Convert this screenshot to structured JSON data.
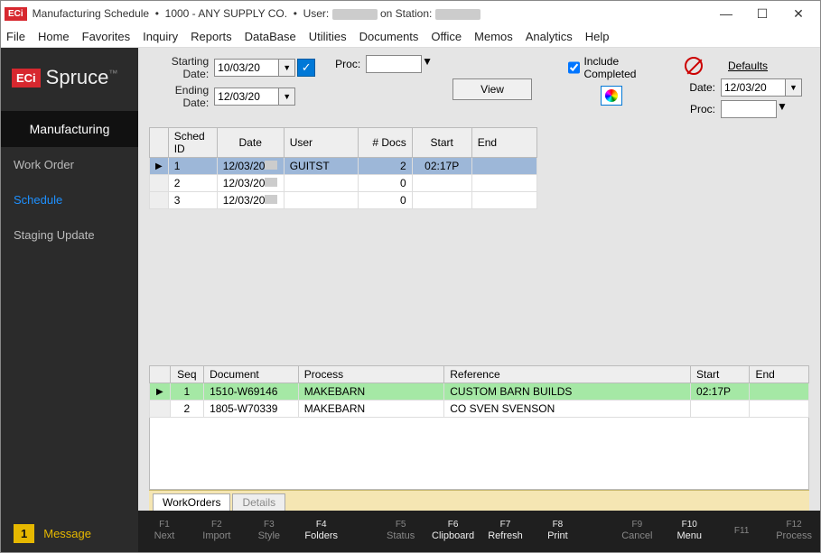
{
  "window": {
    "title_prefix": "Manufacturing Schedule",
    "company": "1000 - ANY SUPPLY CO.",
    "user_label": "User:",
    "station_label": "on Station:"
  },
  "menu": [
    "File",
    "Home",
    "Favorites",
    "Inquiry",
    "Reports",
    "DataBase",
    "Utilities",
    "Documents",
    "Office",
    "Memos",
    "Analytics",
    "Help"
  ],
  "sidebar": {
    "brand_eci": "ECi",
    "brand_name": "Spruce",
    "brand_tm": "™",
    "header": "Manufacturing",
    "items": [
      {
        "label": "Work Order",
        "active": false
      },
      {
        "label": "Schedule",
        "active": true
      },
      {
        "label": "Staging Update",
        "active": false
      }
    ],
    "msg_count": "1",
    "msg_label": "Message"
  },
  "filters": {
    "starting_label": "Starting Date:",
    "starting_value": "10/03/20",
    "ending_label": "Ending Date:",
    "ending_value": "12/03/20",
    "proc_label": "Proc:",
    "view_label": "View",
    "include_label": "Include Completed",
    "include_checked": true
  },
  "defaults": {
    "header": "Defaults",
    "date_label": "Date:",
    "date_value": "12/03/20",
    "proc_label": "Proc:"
  },
  "grid1": {
    "headers": [
      "Sched ID",
      "Date",
      "User",
      "# Docs",
      "Start",
      "End"
    ],
    "rows": [
      {
        "sel": true,
        "id": "1",
        "date": "12/03/20",
        "user": "GUITST",
        "docs": "2",
        "start": "02:17P",
        "end": ""
      },
      {
        "sel": false,
        "id": "2",
        "date": "12/03/20",
        "user": "",
        "docs": "0",
        "start": "",
        "end": ""
      },
      {
        "sel": false,
        "id": "3",
        "date": "12/03/20",
        "user": "",
        "docs": "0",
        "start": "",
        "end": ""
      }
    ]
  },
  "grid2": {
    "headers": [
      "Seq",
      "Document",
      "Process",
      "Reference",
      "Start",
      "End"
    ],
    "rows": [
      {
        "green": true,
        "seq": "1",
        "doc": "1510-W69146",
        "proc": "MAKEBARN",
        "ref": "CUSTOM BARN BUILDS",
        "start": "02:17P",
        "end": ""
      },
      {
        "green": false,
        "seq": "2",
        "doc": "1805-W70339",
        "proc": "MAKEBARN",
        "ref": "CO SVEN SVENSON",
        "start": "",
        "end": ""
      }
    ]
  },
  "tabs": [
    {
      "label": "WorkOrders",
      "active": true
    },
    {
      "label": "Details",
      "active": false
    }
  ],
  "fkeys": [
    {
      "k": "F1",
      "l": "Next",
      "on": false
    },
    {
      "k": "F2",
      "l": "Import",
      "on": false
    },
    {
      "k": "F3",
      "l": "Style",
      "on": false
    },
    {
      "k": "F4",
      "l": "Folders",
      "on": true
    },
    {
      "k": "F5",
      "l": "Status",
      "on": false
    },
    {
      "k": "F6",
      "l": "Clipboard",
      "on": true
    },
    {
      "k": "F7",
      "l": "Refresh",
      "on": true
    },
    {
      "k": "F8",
      "l": "Print",
      "on": true
    },
    {
      "k": "F9",
      "l": "Cancel",
      "on": false
    },
    {
      "k": "F10",
      "l": "Menu",
      "on": true
    },
    {
      "k": "F11",
      "l": "",
      "on": false
    },
    {
      "k": "F12",
      "l": "Process",
      "on": false
    }
  ]
}
